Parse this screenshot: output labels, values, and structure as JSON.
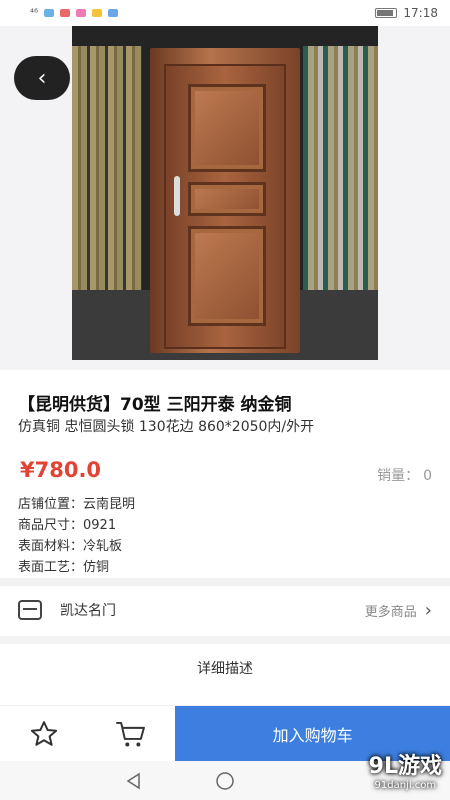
{
  "status_bar": {
    "left": "⁴⁶",
    "time": "17:18"
  },
  "product": {
    "title": "【昆明供货】70型 三阳开泰 纳金铜",
    "subtitle": "仿真铜 忠恒圆头锁 130花边 860*2050内/外开",
    "price": "¥780.0",
    "sales_label": "销量：",
    "sales_value": "0"
  },
  "attributes": [
    {
      "label": "店铺位置：",
      "value": "云南昆明"
    },
    {
      "label": "商品尺寸：",
      "value": "0921"
    },
    {
      "label": "表面材料：",
      "value": "冷轧板"
    },
    {
      "label": "表面工艺：",
      "value": "仿铜"
    }
  ],
  "shop": {
    "name": "凯达名门",
    "more_label": "更多商品"
  },
  "detail_label": "详细描述",
  "bottom": {
    "add_to_cart": "加入购物车"
  },
  "watermark": {
    "text": "9L游戏",
    "url": "91danji.com"
  },
  "icons": {
    "back": "chevron-left-icon",
    "shop": "shop-icon",
    "favorite": "star-icon",
    "cart": "cart-icon",
    "nav_back": "triangle-back-icon",
    "nav_home": "circle-home-icon"
  },
  "colors": {
    "price": "#e24334",
    "cart_button": "#3d7fe0",
    "indicator": "#f0c419"
  }
}
